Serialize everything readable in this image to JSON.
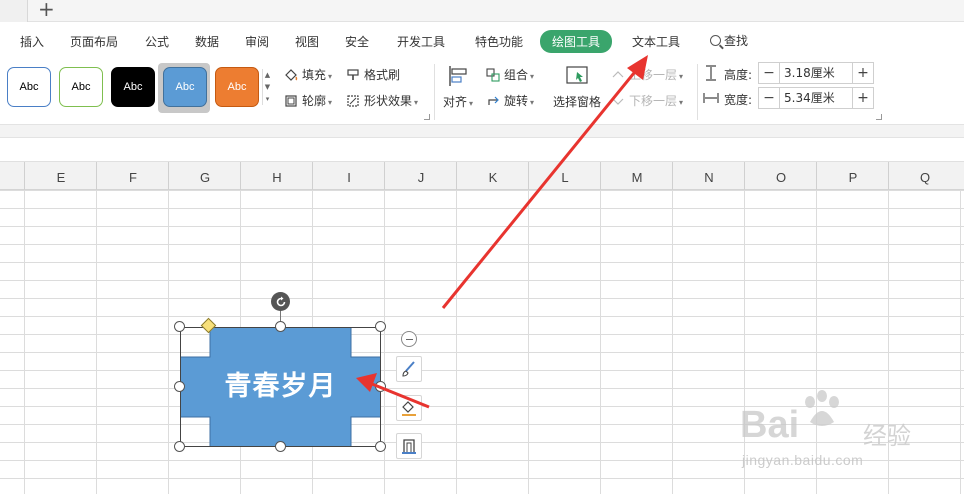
{
  "tabstrip": {
    "new_tab": "+"
  },
  "menu": {
    "items": [
      "插入",
      "页面布局",
      "公式",
      "数据",
      "审阅",
      "视图",
      "安全",
      "开发工具",
      "特色功能",
      "绘图工具",
      "文本工具"
    ],
    "active": "绘图工具",
    "search": "查找"
  },
  "ribbon": {
    "styles": [
      {
        "label": "Abc",
        "bg": "#ffffff",
        "border": "#4a7fc6",
        "text": "#000000"
      },
      {
        "label": "Abc",
        "bg": "#ffffff",
        "border": "#7fbf4f",
        "text": "#000000"
      },
      {
        "label": "Abc",
        "bg": "#000000",
        "border": "#000000",
        "text": "#ffffff"
      },
      {
        "label": "Abc",
        "bg": "#5b9bd5",
        "border": "#41719c",
        "text": "#ffffff"
      },
      {
        "label": "Abc",
        "bg": "#ed7d31",
        "border": "#c55a11",
        "text": "#ffffff"
      }
    ],
    "fill": "填充",
    "format_painter": "格式刷",
    "outline": "轮廓",
    "shape_effects": "形状效果",
    "align": "对齐",
    "group": "组合",
    "rotate": "旋转",
    "selection_pane": "选择窗格",
    "bring_forward": "上移一层",
    "send_backward": "下移一层",
    "height_label": "高度:",
    "height_value": "3.18厘米",
    "width_label": "宽度:",
    "width_value": "5.34厘米"
  },
  "grid": {
    "columns": [
      "E",
      "F",
      "G",
      "H",
      "I",
      "J",
      "K",
      "L",
      "M",
      "N",
      "O",
      "P",
      "Q"
    ]
  },
  "shape": {
    "text": "青春岁月",
    "fill": "#5b9bd5"
  },
  "colors": {
    "accent": "#3aa56c",
    "annotation": "#e8342f"
  },
  "watermark": {
    "brand": "Bai",
    "brand2": "经验",
    "url": "jingyan.baidu.com"
  }
}
